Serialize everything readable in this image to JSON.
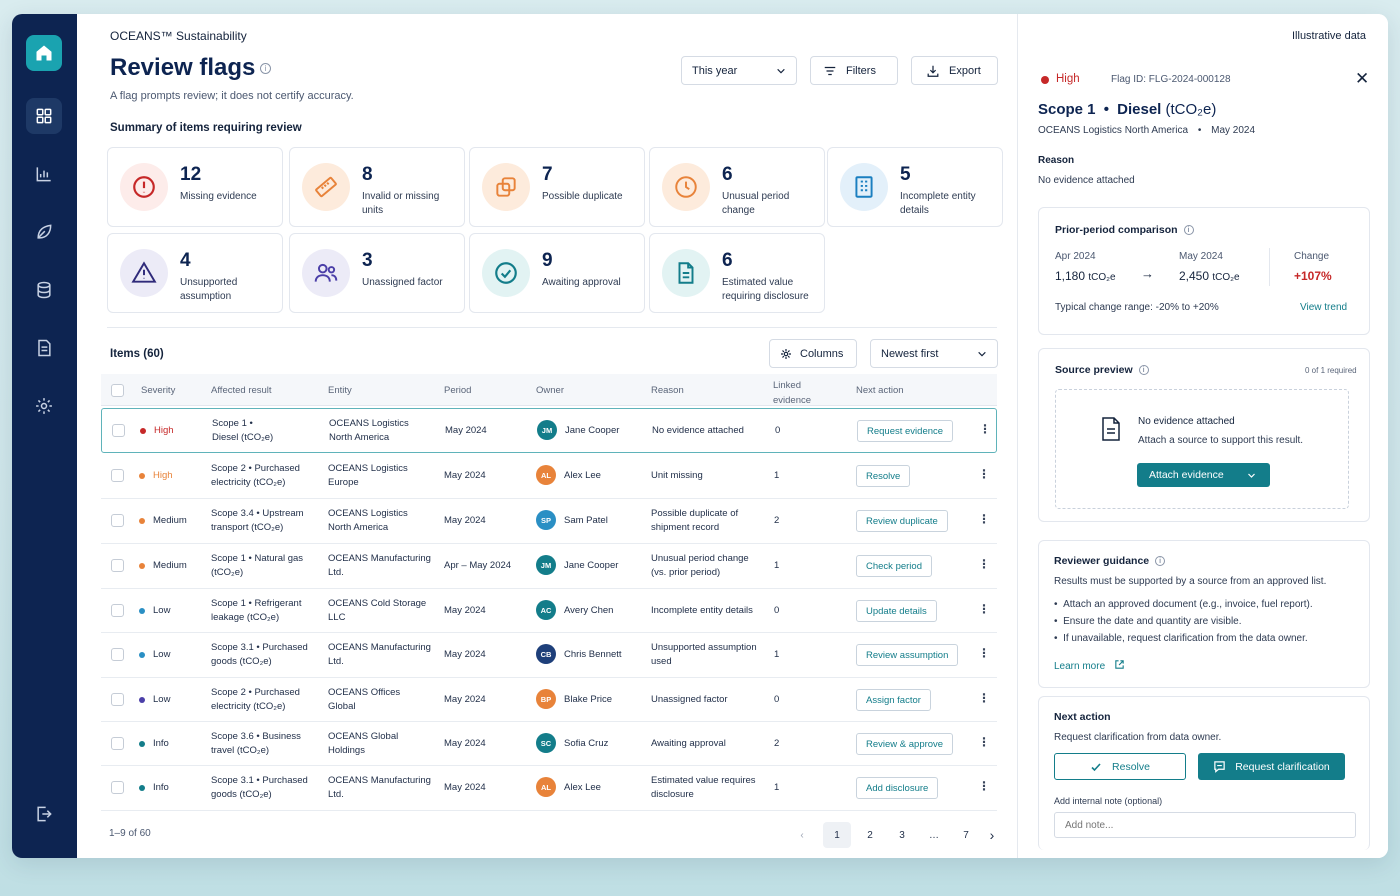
{
  "brand": "OCEANS™ Sustainability",
  "page": {
    "title": "Review flags",
    "subtitle": "A flag prompts review; it does not certify accuracy.",
    "period_select": "This year",
    "filters_label": "Filters",
    "export_label": "Export"
  },
  "summary": {
    "title": "Summary of items requiring review",
    "cards": [
      {
        "count": "12",
        "label": "Missing evidence",
        "icon": "alert-circle-icon",
        "color": "#c62828"
      },
      {
        "count": "8",
        "label": "Invalid or missing units",
        "icon": "ruler-icon",
        "color": "#e8833a"
      },
      {
        "count": "7",
        "label": "Possible duplicate",
        "icon": "copy-icon",
        "color": "#e8833a"
      },
      {
        "count": "6",
        "label": "Unusual period change",
        "icon": "clock-icon",
        "color": "#e8833a"
      },
      {
        "count": "5",
        "label": "Incomplete entity details",
        "icon": "building-icon",
        "color": "#1b7fc0"
      },
      {
        "count": "4",
        "label": "Unsupported assumption",
        "icon": "warning-triangle-icon",
        "color": "#4b3fa8"
      },
      {
        "count": "3",
        "label": "Unassigned factor",
        "icon": "users-icon",
        "color": "#4b3fa8"
      },
      {
        "count": "9",
        "label": "Awaiting approval",
        "icon": "check-circle-icon",
        "color": "#137d8a"
      },
      {
        "count": "6",
        "label": "Estimated value requiring disclosure",
        "icon": "document-icon",
        "color": "#137d8a"
      }
    ]
  },
  "items": {
    "title": "Items (60)",
    "columns_label": "Columns",
    "sort_label": "Newest first",
    "headers": [
      "Severity",
      "Affected result",
      "Entity",
      "Period",
      "Owner",
      "Reason",
      "Linked evidence",
      "Next action"
    ],
    "rows": [
      {
        "severity": "High",
        "sev_color": "#c62828",
        "result_1": "Scope 1 •",
        "result_2": "Diesel (tCO₂e)",
        "entity_1": "OCEANS Logistics",
        "entity_2": "North America",
        "period": "May 2024",
        "initials": "JM",
        "av_color": "#137d8a",
        "owner": "Jane Cooper",
        "reason_1": "No evidence attached",
        "reason_2": "",
        "linked": "0",
        "action": "Request evidence"
      },
      {
        "severity": "High",
        "sev_color": "#e8833a",
        "result_1": "Scope 2 • Purchased",
        "result_2": "electricity (tCO₂e)",
        "entity_1": "OCEANS Logistics",
        "entity_2": "Europe",
        "period": "May 2024",
        "initials": "AL",
        "av_color": "#e8833a",
        "owner": "Alex Lee",
        "reason_1": "Unit missing",
        "reason_2": "",
        "linked": "1",
        "action": "Resolve"
      },
      {
        "severity": "Medium",
        "sev_color": "#e8833a",
        "result_1": "Scope 3.4 • Upstream",
        "result_2": "transport (tCO₂e)",
        "entity_1": "OCEANS Logistics",
        "entity_2": "North America",
        "period": "May 2024",
        "initials": "SP",
        "av_color": "#2a8fc4",
        "owner": "Sam Patel",
        "reason_1": "Possible duplicate of",
        "reason_2": "shipment record",
        "linked": "2",
        "action": "Review duplicate"
      },
      {
        "severity": "Medium",
        "sev_color": "#e8833a",
        "result_1": "Scope 1 • Natural gas",
        "result_2": "(tCO₂e)",
        "entity_1": "OCEANS Manufacturing",
        "entity_2": "Ltd.",
        "period": "Apr – May 2024",
        "initials": "JM",
        "av_color": "#137d8a",
        "owner": "Jane Cooper",
        "reason_1": "Unusual period change",
        "reason_2": "(vs. prior period)",
        "linked": "1",
        "action": "Check period"
      },
      {
        "severity": "Low",
        "sev_color": "#2a8fc4",
        "result_1": "Scope 1 • Refrigerant",
        "result_2": "leakage (tCO₂e)",
        "entity_1": "OCEANS Cold Storage",
        "entity_2": "LLC",
        "period": "May 2024",
        "initials": "AC",
        "av_color": "#137d8a",
        "owner": "Avery Chen",
        "reason_1": "Incomplete entity details",
        "reason_2": "",
        "linked": "0",
        "action": "Update details"
      },
      {
        "severity": "Low",
        "sev_color": "#2a8fc4",
        "result_1": "Scope 3.1 • Purchased",
        "result_2": "goods (tCO₂e)",
        "entity_1": "OCEANS Manufacturing",
        "entity_2": "Ltd.",
        "period": "May 2024",
        "initials": "CB",
        "av_color": "#1e3f7a",
        "owner": "Chris Bennett",
        "reason_1": "Unsupported assumption",
        "reason_2": "used",
        "linked": "1",
        "action": "Review assumption"
      },
      {
        "severity": "Low",
        "sev_color": "#4b3fa8",
        "result_1": "Scope 2 • Purchased",
        "result_2": "electricity (tCO₂e)",
        "entity_1": "OCEANS Offices",
        "entity_2": "Global",
        "period": "May 2024",
        "initials": "BP",
        "av_color": "#e8833a",
        "owner": "Blake Price",
        "reason_1": "Unassigned factor",
        "reason_2": "",
        "linked": "0",
        "action": "Assign factor"
      },
      {
        "severity": "Info",
        "sev_color": "#137d8a",
        "result_1": "Scope 3.6 • Business",
        "result_2": "travel (tCO₂e)",
        "entity_1": "OCEANS Global",
        "entity_2": "Holdings",
        "period": "May 2024",
        "initials": "SC",
        "av_color": "#137d8a",
        "owner": "Sofia Cruz",
        "reason_1": "Awaiting approval",
        "reason_2": "",
        "linked": "2",
        "action": "Review & approve"
      },
      {
        "severity": "Info",
        "sev_color": "#137d8a",
        "result_1": "Scope 3.1 • Purchased",
        "result_2": "goods (tCO₂e)",
        "entity_1": "OCEANS Manufacturing",
        "entity_2": "Ltd.",
        "period": "May 2024",
        "initials": "AL",
        "av_color": "#e8833a",
        "owner": "Alex Lee",
        "reason_1": "Estimated value requires",
        "reason_2": "disclosure",
        "linked": "1",
        "action": "Add disclosure"
      }
    ],
    "footer_count": "1–9 of 60",
    "pages": [
      "1",
      "2",
      "3",
      "…",
      "7"
    ],
    "current_page": "1"
  },
  "panel": {
    "note": "Illustrative data",
    "severity": "High",
    "flag_id": "Flag ID: FLG-2024-000128",
    "title_scope": "Scope 1",
    "title_bullet": "•",
    "title_item": "Diesel",
    "title_unit": "(tCO₂e)",
    "entity_line": "OCEANS Logistics North America",
    "period_line": "May 2024",
    "reason_label": "Reason",
    "reason_value": "No evidence attached",
    "comparison": {
      "title": "Prior-period comparison",
      "prev_label": "Apr 2024",
      "prev_value": "1,180",
      "prev_unit": "tCO₂e",
      "cur_label": "May 2024",
      "cur_value": "2,450",
      "cur_unit": "tCO₂e",
      "change_label": "Change",
      "change_value": "+107%",
      "typical": "Typical change range: -20% to +20%",
      "view_trend": "View trend"
    },
    "source": {
      "title": "Source preview",
      "required": "0 of 1 required",
      "empty_title": "No evidence attached",
      "empty_desc": "Attach a source to support this result.",
      "attach_label": "Attach evidence"
    },
    "guidance": {
      "title": "Reviewer guidance",
      "intro": "Results must be supported by a source from an approved list.",
      "bullets": [
        "Attach an approved document (e.g., invoice, fuel report).",
        "Ensure the date and quantity are visible.",
        "If unavailable, request clarification from the data owner."
      ],
      "learn_more": "Learn more"
    },
    "next_action": {
      "title": "Next action",
      "desc": "Request clarification from data owner.",
      "resolve_label": "Resolve",
      "request_label": "Request clarification",
      "note_label": "Add internal note (optional)",
      "note_placeholder": "Add note..."
    }
  },
  "colors": {
    "sidebar": "#0d2451",
    "accent": "#137d8a",
    "high": "#c62828",
    "change": "#c62828"
  }
}
